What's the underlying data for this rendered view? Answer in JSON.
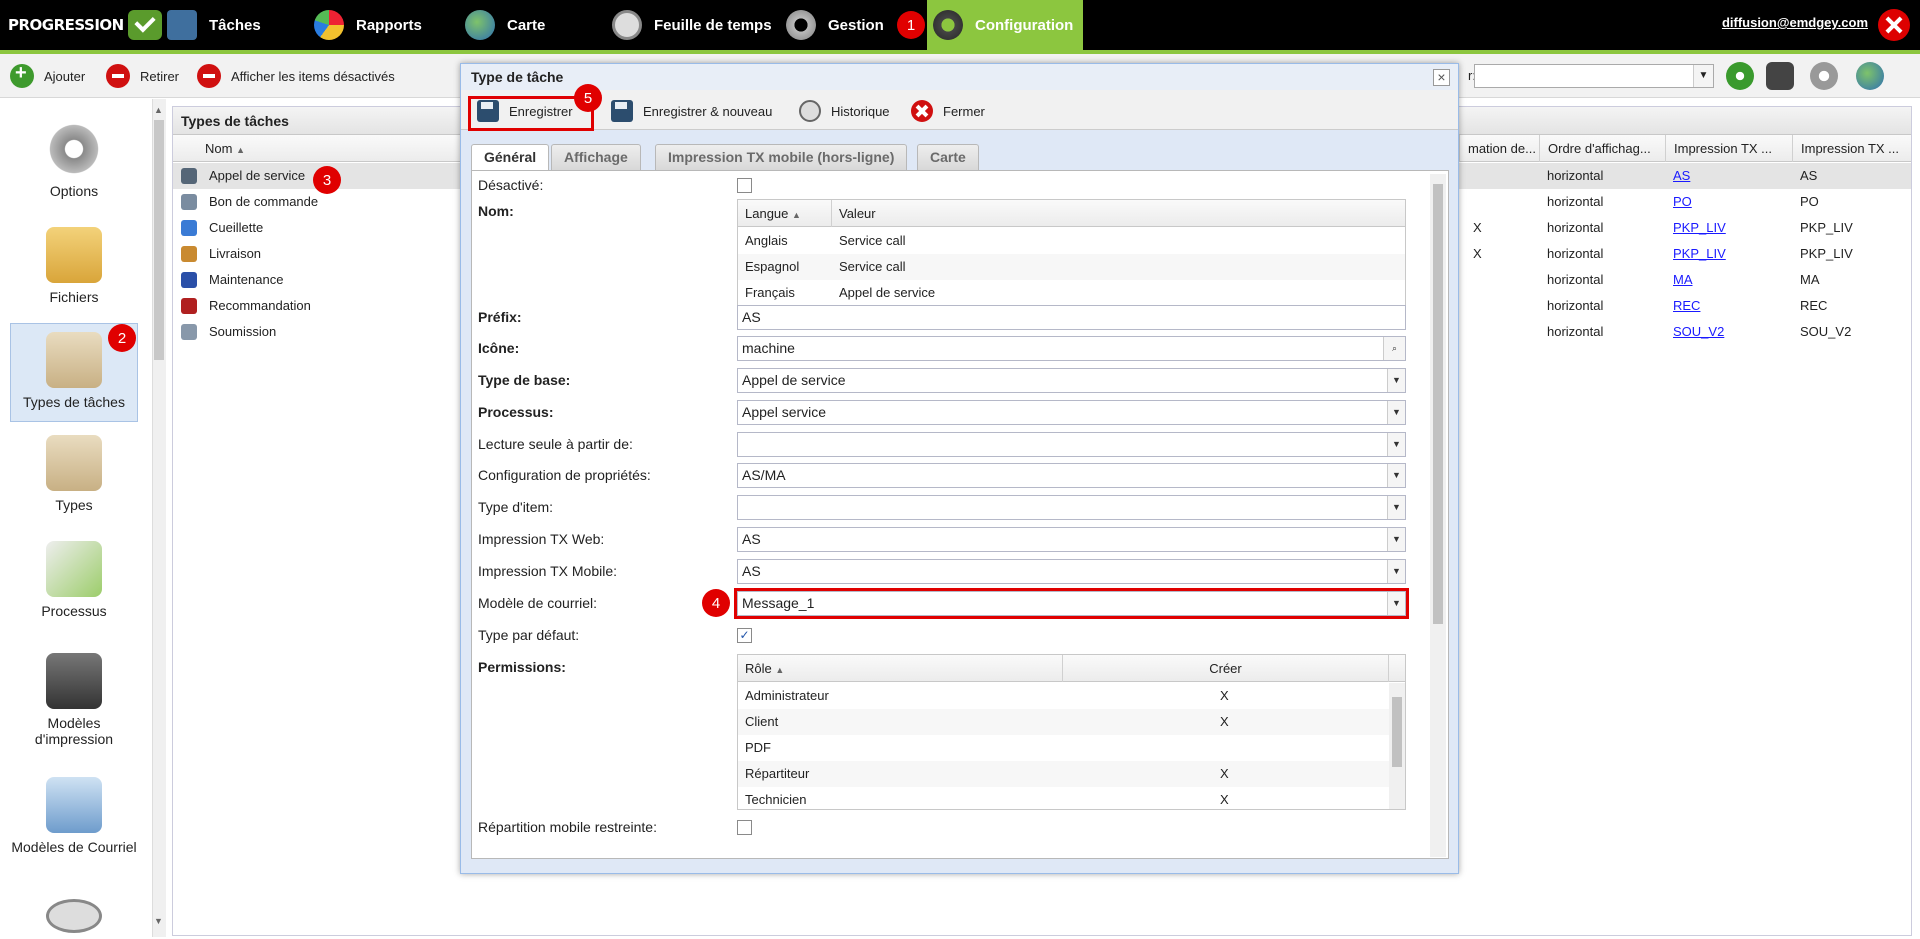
{
  "app": {
    "logo_text": "PROGRESSION",
    "nav": [
      {
        "label": "Tâches",
        "icon": "tasks-icon"
      },
      {
        "label": "Rapports",
        "icon": "reports-icon"
      },
      {
        "label": "Carte",
        "icon": "globe-icon"
      },
      {
        "label": "Feuille de temps",
        "icon": "clock-icon"
      },
      {
        "label": "Gestion",
        "icon": "gears-icon"
      },
      {
        "label": "Configuration",
        "icon": "gears-icon"
      }
    ],
    "user": "diffusion@emdgey.com"
  },
  "annotations": [
    "1",
    "2",
    "3",
    "4",
    "5"
  ],
  "toolbar": {
    "add": "Ajouter",
    "remove": "Retirer",
    "show_disabled": "Afficher les items désactivés",
    "filter_label": "r:"
  },
  "sidebar": {
    "items": [
      {
        "label": "Options",
        "icon": "gear-icon"
      },
      {
        "label": "Fichiers",
        "icon": "folder-icon"
      },
      {
        "label": "Types de tâches",
        "icon": "clipboard-gear-icon"
      },
      {
        "label": "Types",
        "icon": "clipboard-icon"
      },
      {
        "label": "Processus",
        "icon": "process-icon"
      },
      {
        "label": "Modèles d'impression",
        "icon": "printer-icon"
      },
      {
        "label": "Modèles de Courriel",
        "icon": "email-icon"
      }
    ]
  },
  "grid": {
    "title": "Types de tâches",
    "columns": {
      "name": "Nom",
      "confirmation": "mation de...",
      "order": "Ordre d'affichag...",
      "print_web": "Impression TX ...",
      "print_mobile": "Impression TX ..."
    },
    "rows": [
      {
        "name": "Appel de service",
        "x": "",
        "order": "horizontal",
        "print_web": "AS",
        "print_mobile": "AS",
        "color": "#556677"
      },
      {
        "name": "Bon de commande",
        "x": "",
        "order": "horizontal",
        "print_web": "PO",
        "print_mobile": "PO",
        "color": "#7a8ca0"
      },
      {
        "name": "Cueillette",
        "x": "X",
        "order": "horizontal",
        "print_web": "PKP_LIV",
        "print_mobile": "PKP_LIV",
        "color": "#3a7bd5"
      },
      {
        "name": "Livraison",
        "x": "X",
        "order": "horizontal",
        "print_web": "PKP_LIV",
        "print_mobile": "PKP_LIV",
        "color": "#c98a30"
      },
      {
        "name": "Maintenance",
        "x": "",
        "order": "horizontal",
        "print_web": "MA",
        "print_mobile": "MA",
        "color": "#2a4fa8"
      },
      {
        "name": "Recommandation",
        "x": "",
        "order": "horizontal",
        "print_web": "REC",
        "print_mobile": "REC",
        "color": "#b02020"
      },
      {
        "name": "Soumission",
        "x": "",
        "order": "horizontal",
        "print_web": "SOU_V2",
        "print_mobile": "SOU_V2",
        "color": "#8898aa"
      }
    ]
  },
  "dialog": {
    "title": "Type de tâche",
    "close": "×",
    "toolbar": {
      "save": "Enregistrer",
      "save_new": "Enregistrer & nouveau",
      "history": "Historique",
      "close": "Fermer"
    },
    "tabs": [
      "Général",
      "Affichage",
      "Impression TX mobile (hors-ligne)",
      "Carte"
    ],
    "fields": {
      "disabled_label": "Désactivé:",
      "name_label": "Nom:",
      "name_grid": {
        "col_lang": "Langue",
        "col_value": "Valeur",
        "rows": [
          {
            "lang": "Anglais",
            "value": "Service call"
          },
          {
            "lang": "Espagnol",
            "value": "Service call"
          },
          {
            "lang": "Français",
            "value": "Appel de service"
          }
        ]
      },
      "prefix_label": "Préfix:",
      "prefix_value": "AS",
      "icon_label": "Icône:",
      "icon_value": "machine",
      "base_type_label": "Type de base:",
      "base_type_value": "Appel de service",
      "process_label": "Processus:",
      "process_value": "Appel service",
      "readonly_label": "Lecture seule à partir de:",
      "readonly_value": "",
      "props_label": "Configuration de propriétés:",
      "props_value": "AS/MA",
      "item_type_label": "Type d'item:",
      "item_type_value": "",
      "print_web_label": "Impression TX Web:",
      "print_web_value": "AS",
      "print_mobile_label": "Impression TX Mobile:",
      "print_mobile_value": "AS",
      "email_model_label": "Modèle de courriel:",
      "email_model_value": "Message_1",
      "default_type_label": "Type par défaut:",
      "default_type_checked": "✓",
      "permissions_label": "Permissions:",
      "perm_grid": {
        "col_role": "Rôle",
        "col_create": "Créer",
        "rows": [
          {
            "role": "Administrateur",
            "create": "X"
          },
          {
            "role": "Client",
            "create": "X"
          },
          {
            "role": "PDF",
            "create": ""
          },
          {
            "role": "Répartiteur",
            "create": "X"
          },
          {
            "role": "Technicien",
            "create": "X"
          }
        ]
      },
      "cut_label": "Répartition mobile restreinte:"
    }
  }
}
